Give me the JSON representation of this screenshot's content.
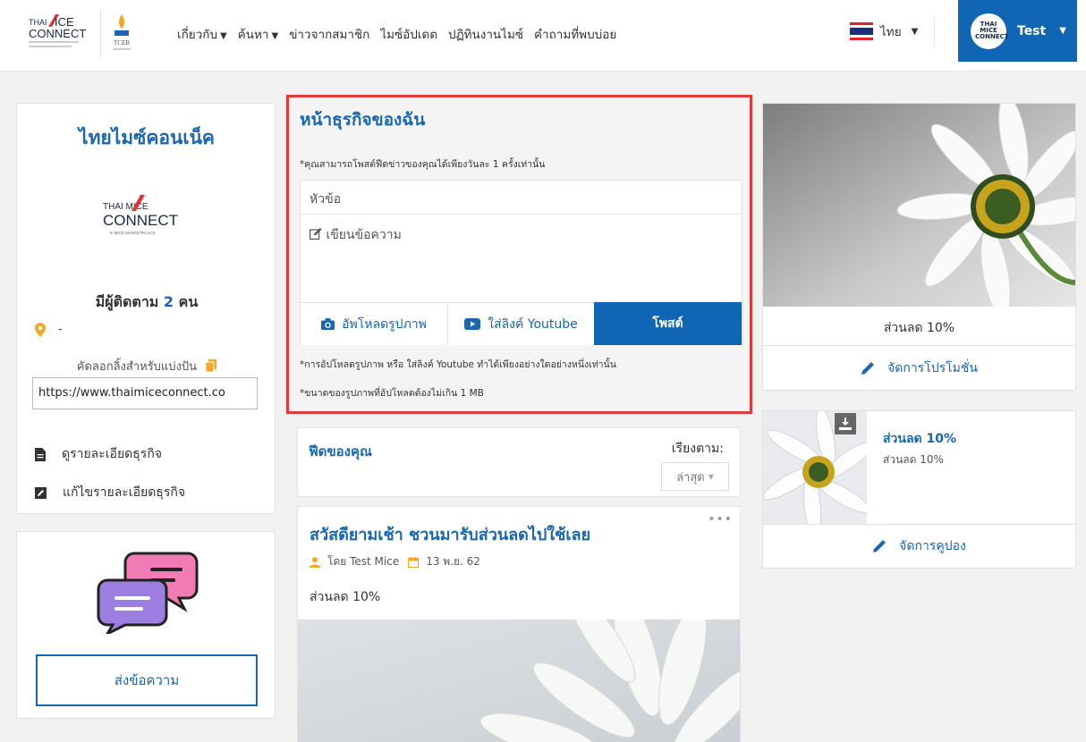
{
  "navbar": {
    "logo_text": "THAI MICE CONNECT",
    "tceb_text": "TCEB",
    "menu": [
      {
        "label": "เกี่ยวกับ",
        "has_caret": true
      },
      {
        "label": "ค้นหา",
        "has_caret": true
      },
      {
        "label": "ข่าวจากสมาชิก",
        "has_caret": false
      },
      {
        "label": "ไมซ์อัปเดต",
        "has_caret": false
      },
      {
        "label": "ปฏิทินงานไมซ์",
        "has_caret": false
      },
      {
        "label": "คำถามที่พบบ่อย",
        "has_caret": false
      }
    ],
    "language": "ไทย",
    "user_name": "Test",
    "avatar_text": "THAI MICE CONNECT"
  },
  "profile": {
    "business_name": "ไทยไมซ์คอนเน็ค",
    "logo_line1": "THAI MICE",
    "logo_line2": "CONNECT",
    "logo_tagline": "E-MICE MARKETPLACE",
    "followers_prefix": "มีผู้ติดตาม",
    "followers_count": "2",
    "followers_suffix": "คน",
    "location": "-",
    "copy_link_label": "คัดลอกลิ้งสำหรับแบ่งปัน",
    "share_url": "https://www.thaimiceconnect.co",
    "view_details": "ดูรายละเอียดธุรกิจ",
    "edit_details": "แก้ไขรายละเอียดธุรกิจ"
  },
  "message": {
    "button": "ส่งข้อความ"
  },
  "post_form": {
    "title": "หน้าธุรกิจของฉัน",
    "note": "*คุณสามารถโพสต์ฟีดข่าวของคุณได้เพียงวันละ 1 ครั้งเท่านั้น",
    "title_placeholder": "หัวข้อ",
    "body_placeholder": "เขียนข้อความ",
    "upload_label": "อัพโหลดรูปภาพ",
    "youtube_label": "ใส่ลิงค์ Youtube",
    "post_label": "โพสต์",
    "note_upload": "*การอัปโหลดรูปภาพ หรือ ใส่ลิงค์ Youtube ทำได้เพียงอย่างใดอย่างหนึ่งเท่านั้น",
    "note_size": "*ขนาดของรูปภาพที่อัปโหลดต้องไม่เกิน 1 MB"
  },
  "feed": {
    "title": "ฟีดของคุณ",
    "sort_label": "เรียงตาม:",
    "sort_value": "ล่าสุด",
    "post": {
      "title": "สวัสดียามเช้า ชวนมารับส่วนลดไปใช้เลย",
      "author": "โดย Test Mice",
      "date": "13 พ.ย. 62",
      "text": "ส่วนลด 10%"
    }
  },
  "promotion": {
    "text": "ส่วนลด 10%",
    "manage_label": "จัดการโปรโมชั่น"
  },
  "coupon": {
    "title": "ส่วนลด 10%",
    "subtitle": "ส่วนลด 10%",
    "manage_label": "จัดการคูปอง"
  },
  "colors": {
    "brand_blue": "#1066b4",
    "highlight_red": "#e03a3a",
    "accent_orange": "#f5a623"
  }
}
